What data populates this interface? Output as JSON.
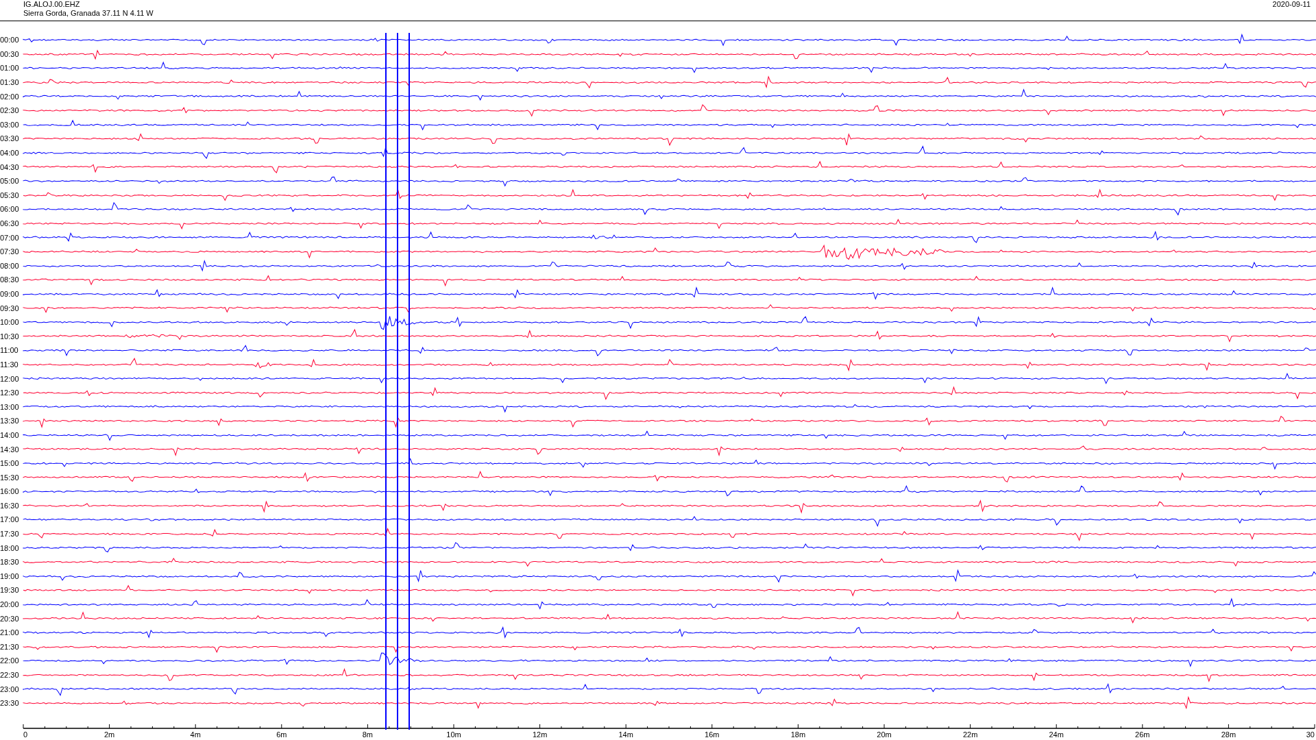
{
  "header": {
    "station": "IG.ALOJ.00.EHZ",
    "location": "Sierra Gorda, Granada  37.11 N 4.11 W",
    "date": "2020-09-11"
  },
  "traces": [
    {
      "time": "00:00",
      "color": "#0000ff"
    },
    {
      "time": "00:30",
      "color": "#ff0033"
    },
    {
      "time": "01:00",
      "color": "#0000ff"
    },
    {
      "time": "01:30",
      "color": "#ff0033"
    },
    {
      "time": "02:00",
      "color": "#0000ff"
    },
    {
      "time": "02:30",
      "color": "#ff0033"
    },
    {
      "time": "03:00",
      "color": "#0000ff"
    },
    {
      "time": "03:30",
      "color": "#ff0033"
    },
    {
      "time": "04:00",
      "color": "#0000ff"
    },
    {
      "time": "04:30",
      "color": "#ff0033"
    },
    {
      "time": "05:00",
      "color": "#0000ff"
    },
    {
      "time": "05:30",
      "color": "#ff0033"
    },
    {
      "time": "06:00",
      "color": "#0000ff"
    },
    {
      "time": "06:30",
      "color": "#ff0033"
    },
    {
      "time": "07:00",
      "color": "#0000ff"
    },
    {
      "time": "07:30",
      "color": "#ff0033"
    },
    {
      "time": "08:00",
      "color": "#0000ff"
    },
    {
      "time": "08:30",
      "color": "#ff0033"
    },
    {
      "time": "09:00",
      "color": "#0000ff"
    },
    {
      "time": "09:30",
      "color": "#ff0033"
    },
    {
      "time": "10:00",
      "color": "#0000ff"
    },
    {
      "time": "10:30",
      "color": "#ff0033"
    },
    {
      "time": "11:00",
      "color": "#0000ff"
    },
    {
      "time": "11:30",
      "color": "#ff0033"
    },
    {
      "time": "12:00",
      "color": "#0000ff"
    },
    {
      "time": "12:30",
      "color": "#ff0033"
    },
    {
      "time": "13:00",
      "color": "#0000ff"
    },
    {
      "time": "13:30",
      "color": "#ff0033"
    },
    {
      "time": "14:00",
      "color": "#0000ff"
    },
    {
      "time": "14:30",
      "color": "#ff0033"
    },
    {
      "time": "15:00",
      "color": "#0000ff"
    },
    {
      "time": "15:30",
      "color": "#ff0033"
    },
    {
      "time": "16:00",
      "color": "#0000ff"
    },
    {
      "time": "16:30",
      "color": "#ff0033"
    },
    {
      "time": "17:00",
      "color": "#0000ff"
    },
    {
      "time": "17:30",
      "color": "#ff0033"
    },
    {
      "time": "18:00",
      "color": "#0000ff"
    },
    {
      "time": "18:30",
      "color": "#ff0033"
    },
    {
      "time": "19:00",
      "color": "#0000ff"
    },
    {
      "time": "19:30",
      "color": "#ff0033"
    },
    {
      "time": "20:00",
      "color": "#0000ff"
    },
    {
      "time": "20:30",
      "color": "#ff0033"
    },
    {
      "time": "21:00",
      "color": "#0000ff"
    },
    {
      "time": "21:30",
      "color": "#ff0033"
    },
    {
      "time": "22:00",
      "color": "#0000ff"
    },
    {
      "time": "22:30",
      "color": "#ff0033"
    },
    {
      "time": "23:00",
      "color": "#0000ff"
    },
    {
      "time": "23:30",
      "color": "#ff0033"
    }
  ],
  "axis": {
    "labels": [
      "0",
      "2m",
      "4m",
      "6m",
      "8m",
      "10m",
      "12m",
      "14m",
      "16m",
      "18m",
      "20m",
      "22m",
      "24m",
      "26m",
      "28m",
      "30"
    ]
  }
}
